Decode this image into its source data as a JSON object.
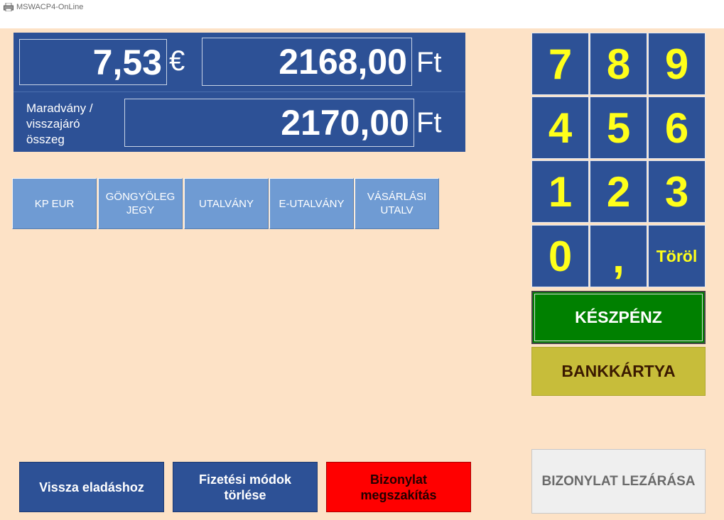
{
  "window": {
    "title": "MSWACP4-OnLine",
    "icon": "printer-icon"
  },
  "display": {
    "eur_amount": "7,53",
    "eur_unit": "€",
    "huf_amount": "2168,00",
    "huf_unit": "Ft",
    "remaining_label": "Maradvány /\nvisszajáró\nösszeg",
    "remaining_amount": "2170,00",
    "remaining_unit": "Ft"
  },
  "payment_methods": [
    "KP EUR",
    "GÖNGYÖLEG\nJEGY",
    "UTALVÁNY",
    "E-UTALVÁNY",
    "VÁSÁRLÁSI\nUTALV"
  ],
  "keypad": {
    "keys": [
      "7",
      "8",
      "9",
      "4",
      "5",
      "6",
      "1",
      "2",
      "3",
      "0",
      ",",
      "Töröl"
    ]
  },
  "actions": {
    "cash": "KÉSZPÉNZ",
    "card": "BANKKÁRTYA",
    "close_receipt": "BIZONYLAT LEZÁRÁSA",
    "back_to_sale": "Vissza eladáshoz",
    "clear_methods": "Fizetési módok\ntörlése",
    "abort_receipt": "Bizonylat\nmegszakítás"
  },
  "colors": {
    "panel_blue": "#2d5196",
    "key_digit": "#ffff1a",
    "method_blue": "#6f9bd3",
    "cash_green": "#008000",
    "card_olive": "#c7bd3a",
    "abort_red": "#ff0000",
    "background": "#fde2c6"
  }
}
